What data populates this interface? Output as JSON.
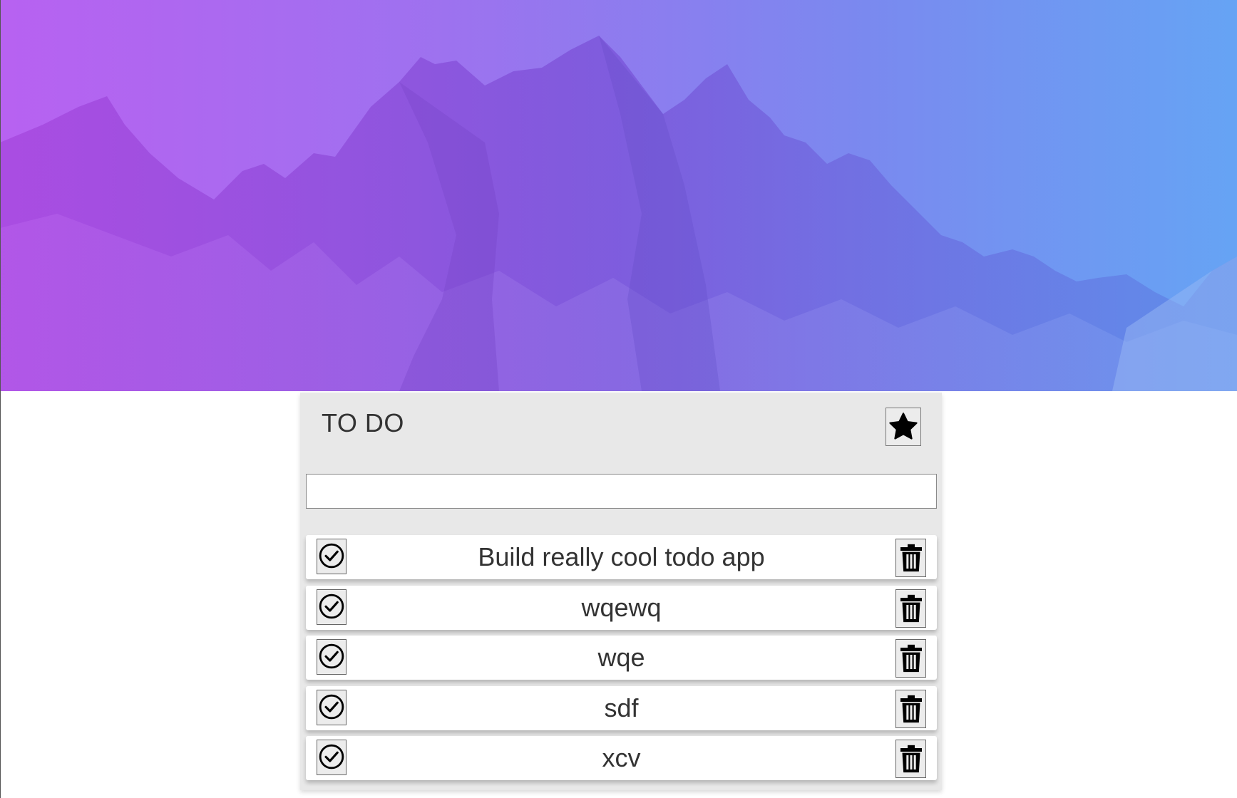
{
  "hero": {
    "image_name": "mountain-range-banner",
    "gradient_colors": [
      "#b46bf2",
      "#7d8cf0",
      "#6aa8f5"
    ]
  },
  "card": {
    "title": "TO DO",
    "favorite_icon": "star-icon",
    "input": {
      "value": "",
      "placeholder": ""
    },
    "complete_icon": "check-circle-icon",
    "delete_icon": "trash-icon",
    "items": [
      {
        "text": "Build really cool todo app"
      },
      {
        "text": "wqewq"
      },
      {
        "text": "wqe"
      },
      {
        "text": "sdf"
      },
      {
        "text": "xcv"
      }
    ]
  }
}
